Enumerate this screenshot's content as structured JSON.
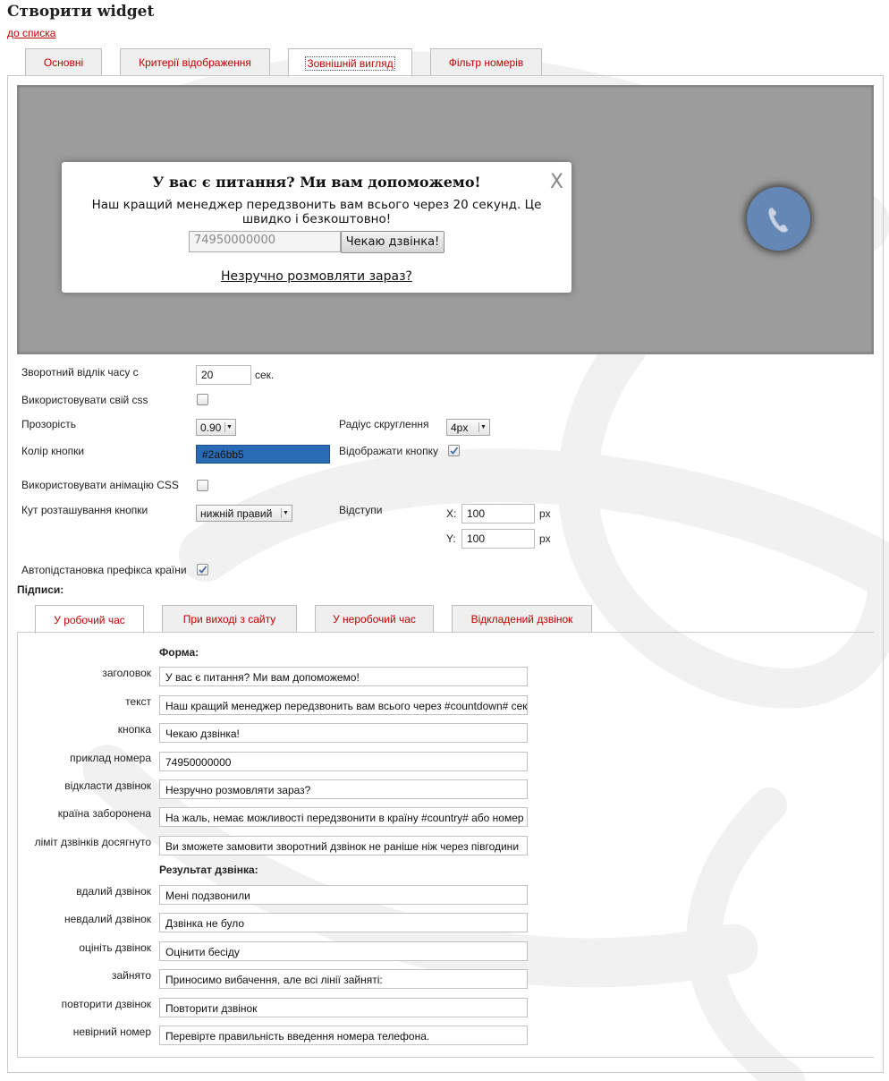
{
  "page": {
    "title": "Створити widget",
    "back_link": "до списка"
  },
  "tabs": [
    {
      "label": "Основні",
      "active": false
    },
    {
      "label": "Критерії відображення",
      "active": false
    },
    {
      "label": "Зовнішній вигляд",
      "active": true
    },
    {
      "label": "Фільтр номерів",
      "active": false
    }
  ],
  "preview": {
    "popup_title": "У вас є питання? Ми вам допоможемо!",
    "close": "X",
    "popup_text": "Наш кращий менеджер передзвонить вам всього через 20 секунд. Це швидко і безкоштовно!",
    "phone_placeholder": "74950000000",
    "call_button": "Чекаю дзвінка!",
    "later_link": "Незручно розмовляти зараз?",
    "call_icon": "phone-icon",
    "call_button_color": "#6587b6",
    "background_color": "#9c9c9c"
  },
  "settings": {
    "countdown_label": "Зворотний відлік часу с",
    "countdown_value": "20",
    "countdown_unit": "сек.",
    "own_css_label": "Використовувати свій css",
    "own_css_checked": false,
    "opacity_label": "Прозорість",
    "opacity_value": "0.90",
    "radius_label": "Радіус скруглення",
    "radius_value": "4px",
    "button_color_label": "Колір кнопки",
    "button_color_value": "#2a6bb5",
    "button_color": "#2a6bb5",
    "show_button_label": "Відображати кнопку",
    "show_button_checked": true,
    "css_animation_label": "Використовувати анімацію CSS",
    "css_animation_checked": false,
    "corner_label": "Кут розташування кнопки",
    "corner_value": "нижній правий",
    "offsets_label": "Відступи",
    "offset_x_label": "X:",
    "offset_x_value": "100",
    "offset_y_label": "Y:",
    "offset_y_value": "100",
    "px_unit": "px",
    "autoprefix_label": "Автопідстановка префікса країни",
    "autoprefix_checked": true,
    "captions_label": "Підписи:"
  },
  "subtabs": [
    {
      "label": "У робочий час",
      "active": true
    },
    {
      "label": "При виході з сайту",
      "active": false
    },
    {
      "label": "У неробочий час",
      "active": false
    },
    {
      "label": "Відкладений дзвінок",
      "active": false
    }
  ],
  "form_section": {
    "title": "Форма:",
    "fields": [
      {
        "label": "заголовок",
        "value": "У вас є питання? Ми вам допоможемо!"
      },
      {
        "label": "текст",
        "value": "Наш кращий менеджер передзвонить вам всього через #countdown# секунд. Це швидко і безкоштовно!"
      },
      {
        "label": "кнопка",
        "value": "Чекаю дзвінка!"
      },
      {
        "label": "приклад номера",
        "value": "74950000000"
      },
      {
        "label": "відкласти дзвінок",
        "value": "Незручно розмовляти зараз?"
      },
      {
        "label": "країна заборонена",
        "value": "На жаль, немає можливості передзвонити в країну #country# або номер"
      },
      {
        "label": "ліміт дзвінків досягнуто",
        "value": "Ви зможете замовити зворотний дзвінок не раніше ніж через півгодини"
      }
    ]
  },
  "result_section": {
    "title": "Результат дзвінка:",
    "fields": [
      {
        "label": "вдалий дзвінок",
        "value": "Мені подзвонили"
      },
      {
        "label": "невдалий дзвінок",
        "value": "Дзвінка не було"
      },
      {
        "label": "оцініть дзвінок",
        "value": "Оцінити бесіду"
      },
      {
        "label": "зайнято",
        "value": "Приносимо вибачення, але всі лінії зайняті:"
      },
      {
        "label": "повторити дзвінок",
        "value": "Повторити дзвінок"
      },
      {
        "label": "невірний номер",
        "value": "Перевірте правильність введення номера телефона."
      }
    ]
  }
}
